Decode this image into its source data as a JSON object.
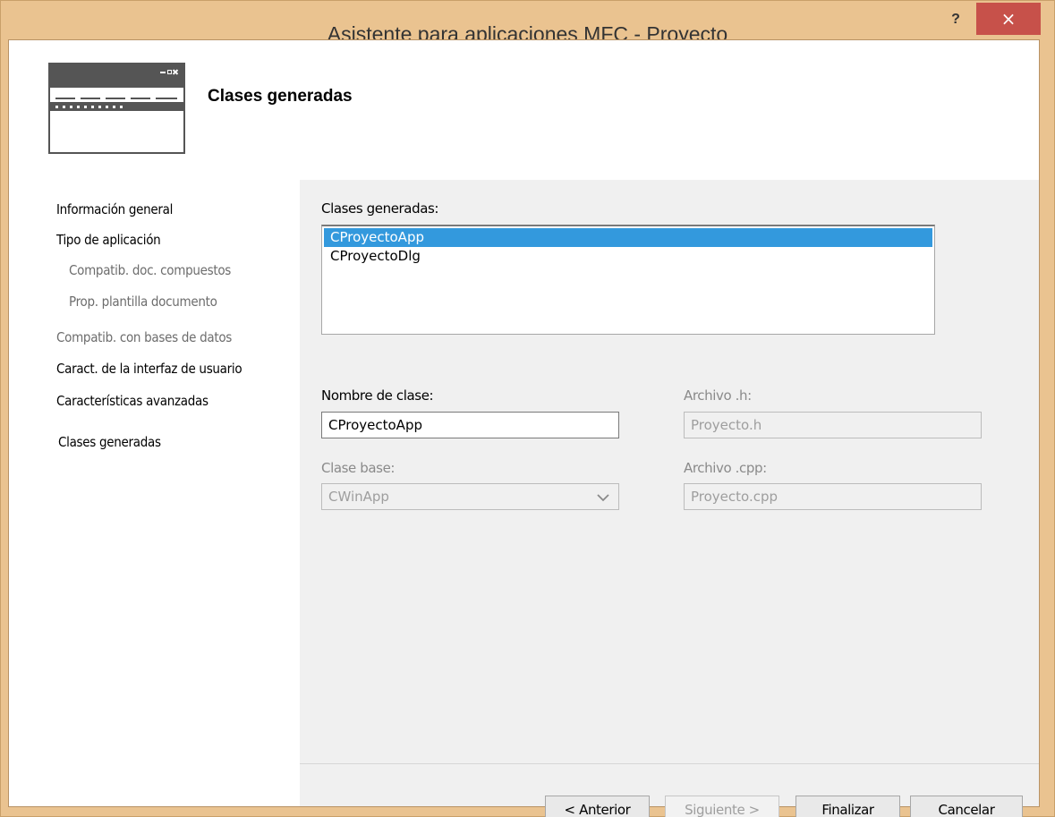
{
  "window": {
    "title": "Asistente para aplicaciones MFC - Proyecto",
    "help_label": "?",
    "close_label": "×"
  },
  "header": {
    "title": "Clases generadas"
  },
  "sidebar": {
    "items": [
      {
        "label": "Información general",
        "enabled": true
      },
      {
        "label": "Tipo de aplicación",
        "enabled": true
      },
      {
        "label": "Compatib. doc. compuestos",
        "enabled": false
      },
      {
        "label": "Prop. plantilla documento",
        "enabled": false
      },
      {
        "label": "Compatib. con bases de datos",
        "enabled": false
      },
      {
        "label": "Caract. de la interfaz de usuario",
        "enabled": true
      },
      {
        "label": "Características avanzadas",
        "enabled": true
      },
      {
        "label": "Clases generadas",
        "enabled": true,
        "selected": true
      }
    ]
  },
  "main": {
    "classes_label": "Clases generadas:",
    "classes": [
      {
        "name": "CProyectoApp",
        "selected": true
      },
      {
        "name": "CProyectoDlg",
        "selected": false
      }
    ],
    "class_name_label": "Nombre de clase:",
    "class_name_value": "CProyectoApp",
    "base_class_label": "Clase base:",
    "base_class_value": "CWinApp",
    "h_file_label": "Archivo .h:",
    "h_file_value": "Proyecto.h",
    "cpp_file_label": "Archivo .cpp:",
    "cpp_file_value": "Proyecto.cpp"
  },
  "buttons": {
    "back": "< Anterior",
    "next": "Siguiente >",
    "finish": "Finalizar",
    "cancel": "Cancelar"
  },
  "colors": {
    "title_bar": "#eac390",
    "close_button": "#c7514a",
    "selection": "#3399dd"
  }
}
